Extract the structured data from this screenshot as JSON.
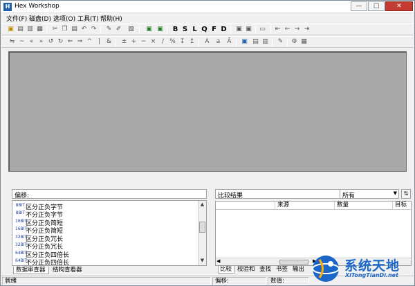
{
  "window": {
    "title": "Hex Workshop",
    "app_icon": "H"
  },
  "menu": [
    "文件(F)",
    "磁盘(D)",
    "选项(O)",
    "工具(T)",
    "帮助(H)"
  ],
  "toolbar1": {
    "letters": [
      "B",
      "S",
      "L",
      "Q",
      "F",
      "D"
    ]
  },
  "left_panel": {
    "header": "偏移:",
    "rows": [
      {
        "bits": "8BIT",
        "label": "区分正负字节"
      },
      {
        "bits": "8BIT",
        "label": "不分正负字节"
      },
      {
        "bits": "16BIT",
        "label": "区分正负简短"
      },
      {
        "bits": "16BIT",
        "label": "不分正负简短"
      },
      {
        "bits": "32BIT",
        "label": "区分正负冗长"
      },
      {
        "bits": "32BIT",
        "label": "不分正负冗长"
      },
      {
        "bits": "64BIT",
        "label": "区分正负四倍长"
      },
      {
        "bits": "64BIT",
        "label": "不分正负四倍长"
      }
    ],
    "tabs": [
      "数据审查器",
      "结构查看器"
    ]
  },
  "right_panel": {
    "header": "比较结果",
    "select_value": "所有",
    "columns": [
      "",
      "来源",
      "数量",
      "目标"
    ],
    "tabs": [
      "比较",
      "校验和",
      "查找",
      "书签",
      "输出"
    ]
  },
  "status": {
    "ready": "就绪",
    "offset": "偏移:",
    "value": "数值:"
  },
  "watermark": {
    "text": "系统天地",
    "sub": "XiTongTianDi.net"
  },
  "colors": {
    "workspace": "#a9a9a9",
    "watermark": "#1a66c9",
    "bit_label": "#1f3fa8"
  }
}
